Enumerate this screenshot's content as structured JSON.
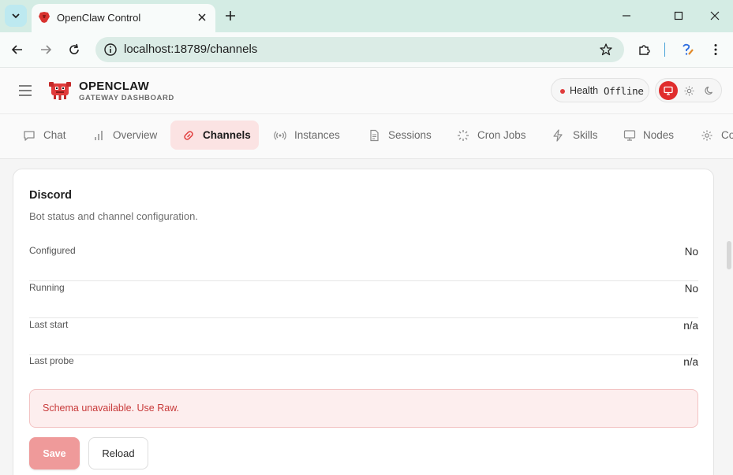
{
  "browser": {
    "tab_title": "OpenClaw Control",
    "url": "localhost:18789/channels"
  },
  "app": {
    "brand_title": "OPENCLAW",
    "brand_subtitle": "GATEWAY DASHBOARD",
    "health_label": "Health",
    "health_value": "Offline",
    "health_status_color": "#e03b3b",
    "accent_color": "#e02d2d",
    "theme_options": [
      "system",
      "light",
      "dark"
    ],
    "theme_selected": "system"
  },
  "nav": {
    "items": [
      {
        "label": "Chat",
        "icon": "message-icon"
      },
      {
        "label": "Overview",
        "icon": "bar-chart-icon"
      },
      {
        "label": "Channels",
        "icon": "link-icon",
        "active": true
      },
      {
        "label": "Instances",
        "icon": "broadcast-icon"
      },
      {
        "label": "Sessions",
        "icon": "document-icon"
      },
      {
        "label": "Cron Jobs",
        "icon": "loader-icon"
      },
      {
        "label": "Skills",
        "icon": "lightning-icon"
      },
      {
        "label": "Nodes",
        "icon": "monitor-icon"
      },
      {
        "label": "Co",
        "icon": "gear-icon"
      }
    ]
  },
  "card": {
    "title": "Discord",
    "subtitle": "Bot status and channel configuration.",
    "rows": [
      {
        "label": "Configured",
        "value": "No"
      },
      {
        "label": "Running",
        "value": "No"
      },
      {
        "label": "Last start",
        "value": "n/a"
      },
      {
        "label": "Last probe",
        "value": "n/a"
      }
    ],
    "alert": "Schema unavailable. Use Raw.",
    "save_label": "Save",
    "reload_label": "Reload"
  }
}
